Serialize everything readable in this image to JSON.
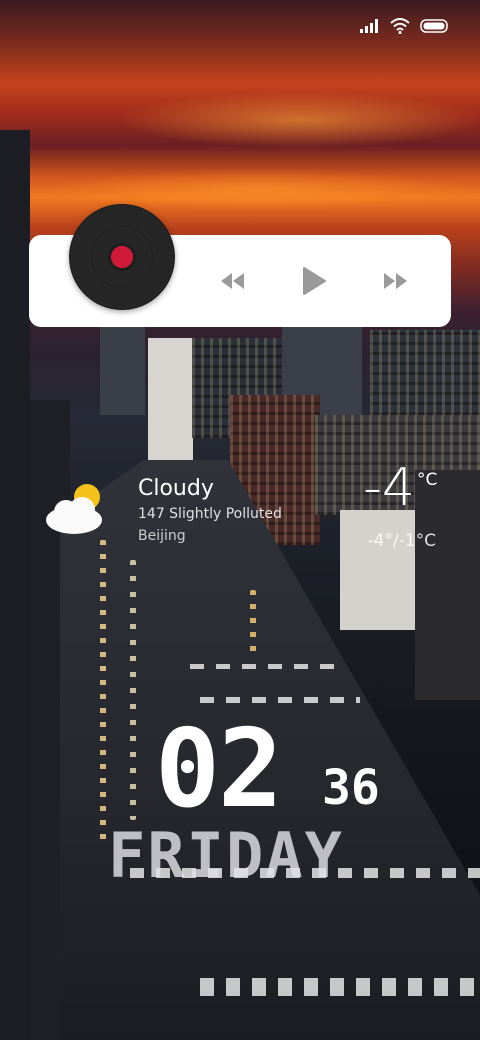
{
  "status_bar": {
    "signal_icon": "cellular-signal-icon",
    "wifi_icon": "wifi-icon",
    "battery_icon": "battery-icon"
  },
  "music_widget": {
    "disc_icon": "vinyl-record-icon",
    "accent_color": "#d11a3a",
    "controls": {
      "previous_icon": "rewind-icon",
      "play_icon": "play-icon",
      "next_icon": "fast-forward-icon"
    },
    "control_color": "#9a9a9a"
  },
  "weather": {
    "icon": "partly-cloudy-icon",
    "condition": "Cloudy",
    "aqi_text": "147  Slightly Polluted",
    "city": "Beijing",
    "temperature": "-4",
    "unit": "°C",
    "range": "-4°/-1°C"
  },
  "clock": {
    "hour": "02",
    "minute": "36",
    "day": "FRIDAY"
  }
}
